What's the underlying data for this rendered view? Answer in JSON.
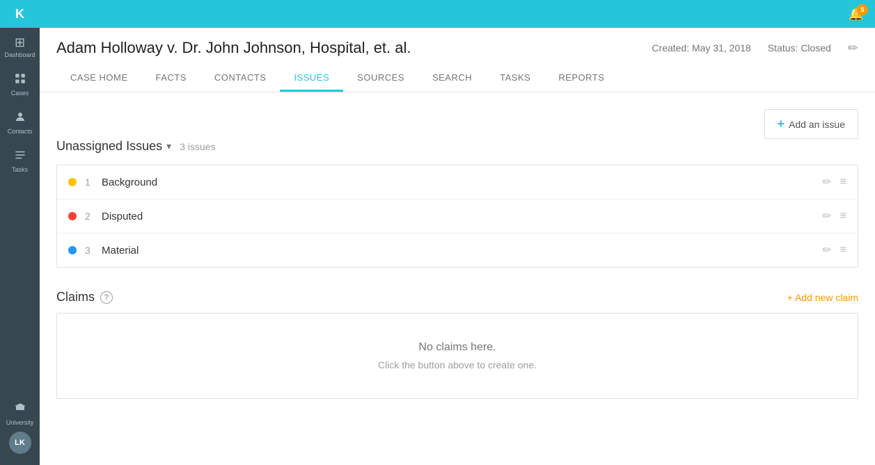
{
  "app": {
    "logo": "K",
    "notification_count": "5"
  },
  "sidebar": {
    "items": [
      {
        "id": "dashboard",
        "label": "Dashboard",
        "icon": "⊞"
      },
      {
        "id": "cases",
        "label": "Cases",
        "icon": "📋"
      },
      {
        "id": "contacts",
        "label": "Contacts",
        "icon": "👤"
      },
      {
        "id": "tasks",
        "label": "Tasks",
        "icon": "☑"
      }
    ],
    "university_label": "University",
    "avatar_initials": "LK"
  },
  "case": {
    "title": "Adam Holloway v. Dr. John Johnson, Hospital, et. al.",
    "created": "Created: May 31, 2018",
    "status": "Status: Closed"
  },
  "nav": {
    "tabs": [
      {
        "id": "case-home",
        "label": "CASE HOME",
        "active": false
      },
      {
        "id": "facts",
        "label": "FACTS",
        "active": false
      },
      {
        "id": "contacts",
        "label": "CONTACTS",
        "active": false
      },
      {
        "id": "issues",
        "label": "ISSUES",
        "active": true
      },
      {
        "id": "sources",
        "label": "SOURCES",
        "active": false
      },
      {
        "id": "search",
        "label": "SEARCH",
        "active": false
      },
      {
        "id": "tasks",
        "label": "TASKS",
        "active": false
      },
      {
        "id": "reports",
        "label": "REPORTS",
        "active": false
      }
    ]
  },
  "toolbar": {
    "add_issue_label": "Add an issue"
  },
  "unassigned": {
    "title": "Unassigned Issues",
    "count": "3 issues",
    "issues": [
      {
        "id": 1,
        "num": "1",
        "name": "Background",
        "dot": "yellow"
      },
      {
        "id": 2,
        "num": "2",
        "name": "Disputed",
        "dot": "red"
      },
      {
        "id": 3,
        "num": "3",
        "name": "Material",
        "dot": "blue"
      }
    ]
  },
  "claims": {
    "title": "Claims",
    "add_label": "+ Add new claim",
    "empty_text": "No claims here.",
    "empty_sub": "Click the button above to create one."
  }
}
